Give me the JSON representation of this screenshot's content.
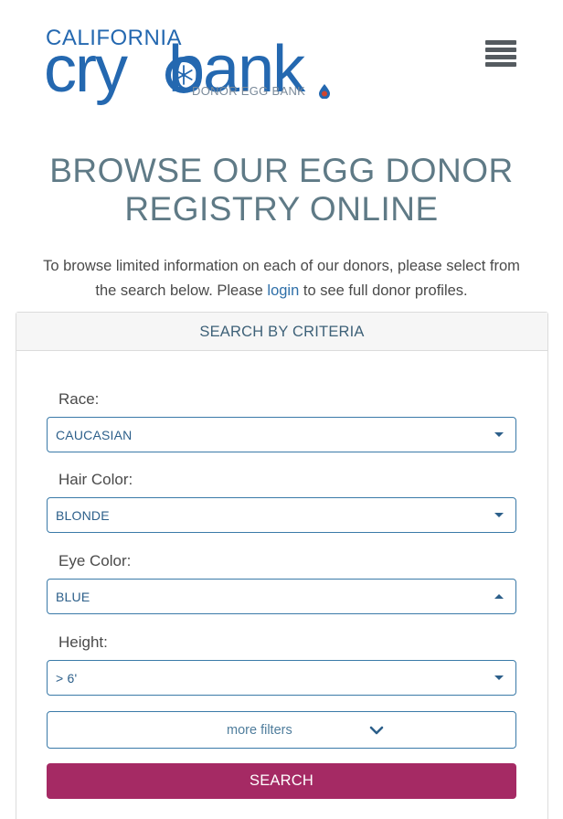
{
  "brand": {
    "top": "CALIFORNIA",
    "main_left": "cry",
    "main_right": "bank",
    "sub": "DONOR EGG BANK"
  },
  "colors": {
    "brand_blue": "#2468b0",
    "title_gray": "#5f7a86",
    "button_magenta": "#a52a64",
    "select_border": "#3a7aa8"
  },
  "menu": {
    "icon": "hamburger-menu-icon"
  },
  "page": {
    "title_line1": "BROWSE OUR EGG DONOR",
    "title_line2": "REGISTRY ONLINE",
    "intro_line1": "To browse limited information on each of our donors, please select from",
    "intro_line2_pre": "the search below. Please ",
    "intro_link": "login",
    "intro_line2_post": " to see full donor profiles."
  },
  "search": {
    "heading": "SEARCH BY CRITERIA",
    "fields": [
      {
        "label": "Race:",
        "value": "CAUCASIAN",
        "open": false
      },
      {
        "label": "Hair Color:",
        "value": "BLONDE",
        "open": false
      },
      {
        "label": "Eye Color:",
        "value": "BLUE",
        "open": true
      },
      {
        "label": "Height:",
        "value": "> 6'",
        "open": false
      }
    ],
    "more_filters": "more filters",
    "submit": "SEARCH"
  }
}
